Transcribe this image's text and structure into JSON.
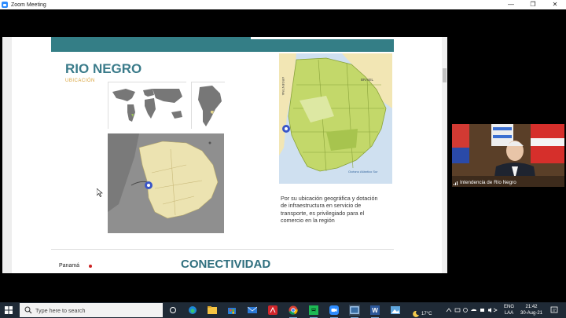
{
  "window": {
    "title": "Zoom Meeting",
    "controls": [
      "—",
      "❐",
      "✕"
    ]
  },
  "slide": {
    "title": "RIO NEGRO",
    "subtitle": "UBICACIÓN",
    "paragraph": "Por su ubicación geográfica y dotación de infraestructura en servicio de transporte, es privilegiado para el comercio en la región",
    "next_section_title": "CONECTIVIDAD",
    "next_label": "Panamá",
    "map_labels": {
      "argentina": "ARGENTINA",
      "brasil": "BRASIL",
      "oceano": "Océano Atlántico Sur"
    }
  },
  "video": {
    "participant": "Intendencia de Río Negro"
  },
  "taskbar": {
    "search_placeholder": "Type here to search",
    "weather": "17°C",
    "lang_top": "ENG",
    "lang_bottom": "LAA",
    "time": "21:42",
    "date": "30-Aug-21",
    "apps": [
      "task-view-icon",
      "edge-icon",
      "file-explorer-icon",
      "store-icon",
      "acrobat-icon",
      "chrome-icon",
      "spotify-icon",
      "mail-icon",
      "zoom-icon",
      "word-icon",
      "photos-icon"
    ]
  },
  "colors": {
    "teal": "#347e86",
    "title": "#3a7b8a",
    "subtitle": "#d9a23a",
    "taskbar": "#1f2a36",
    "zoom_blue": "#2D8CFF"
  }
}
